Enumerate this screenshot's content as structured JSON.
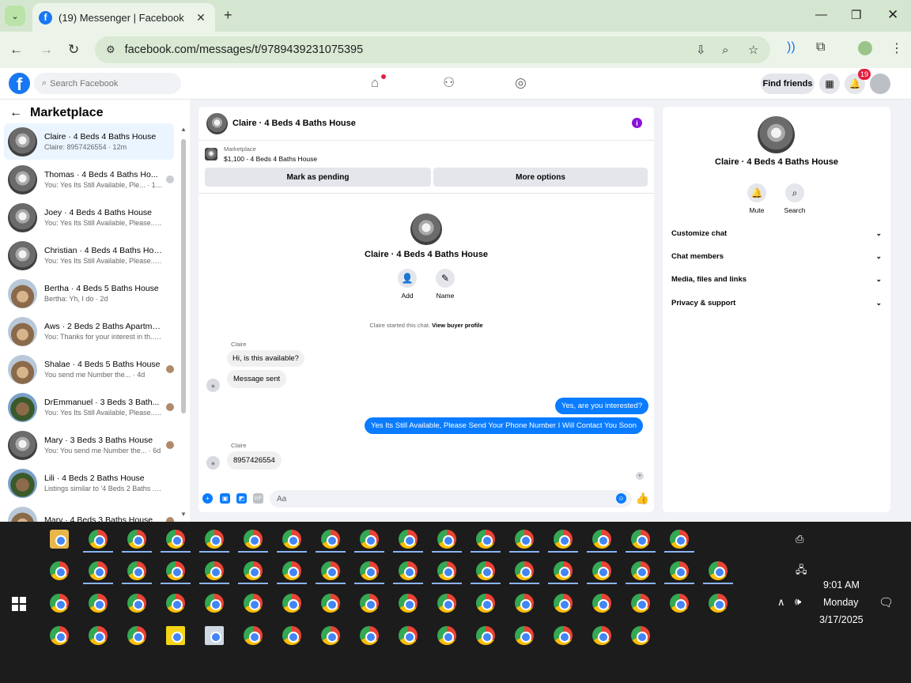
{
  "browser": {
    "tab_title": "(19) Messenger | Facebook",
    "url": "facebook.com/messages/t/9789439231075395"
  },
  "fb": {
    "search_placeholder": "Search Facebook",
    "find_friends": "Find friends",
    "notif_count": "19"
  },
  "sidebar": {
    "title": "Marketplace",
    "conversations": [
      {
        "name": "Claire · 4 Beds 4 Baths House",
        "preview": "Claire: 8957426554 · 12m",
        "active": true
      },
      {
        "name": "Thomas · 4 Beds 4 Baths Ho...",
        "preview": "You: Yes Its Still Available, Ple... · 12m"
      },
      {
        "name": "Joey · 4 Beds 4 Baths House",
        "preview": "You: Yes Its Still Available, Please... · 12m"
      },
      {
        "name": "Christian · 4 Beds 4 Baths House",
        "preview": "You: Yes Its Still Available, Please... · 12m"
      },
      {
        "name": "Bertha · 4 Beds 5 Baths House",
        "preview": "Bertha: Yh, I do · 2d"
      },
      {
        "name": "Aws · 2 Beds 2 Baths Apartmen...",
        "preview": "You: Thanks for your interest in th... · 3d"
      },
      {
        "name": "Shalae · 4 Beds 5 Baths House",
        "preview": "You send me Number the... · 4d"
      },
      {
        "name": "DrEmmanuel · 3 Beds 3 Bath...",
        "preview": "You: Yes Its Still Available, Please... · 4d"
      },
      {
        "name": "Mary · 3 Beds 3 Baths House",
        "preview": "You: You send me Number the... · 6d"
      },
      {
        "name": "Lili · 4 Beds 2 Baths House",
        "preview": "Listings similar to '4 Beds 2 Baths ... · 1w"
      },
      {
        "name": "Mary · 4 Beds 3 Baths House",
        "preview": ""
      }
    ]
  },
  "chat": {
    "title": "Claire · 4 Beds 4 Baths House",
    "marketplace_label": "Marketplace",
    "listing": "$1,100 - 4 Beds 4 Baths House",
    "mark_pending": "Mark as pending",
    "more_options": "More options",
    "profile_name": "Claire · 4 Beds 4 Baths House",
    "add_label": "Add",
    "name_label": "Name",
    "started_text": "Claire started this chat.",
    "view_profile": "View buyer profile",
    "messages": [
      {
        "from": "Claire",
        "text": "Hi, is this available?"
      },
      {
        "from": "Claire",
        "text": "Message sent"
      },
      {
        "from": "me",
        "text": "Yes, are you interested?"
      },
      {
        "from": "me",
        "text": "Yes Its Still Available, Please Send Your Phone Number I Will Contact You Soon"
      },
      {
        "from": "Claire",
        "text": "8957426554"
      }
    ],
    "sender_label": "Claire",
    "composer_placeholder": "Aa"
  },
  "right_panel": {
    "name": "Claire · 4 Beds 4 Baths House",
    "mute": "Mute",
    "search": "Search",
    "sections": [
      "Customize chat",
      "Chat members",
      "Media, files and links",
      "Privacy & support"
    ]
  },
  "taskbar": {
    "time": "9:01 AM",
    "day": "Monday",
    "date": "3/17/2025"
  }
}
